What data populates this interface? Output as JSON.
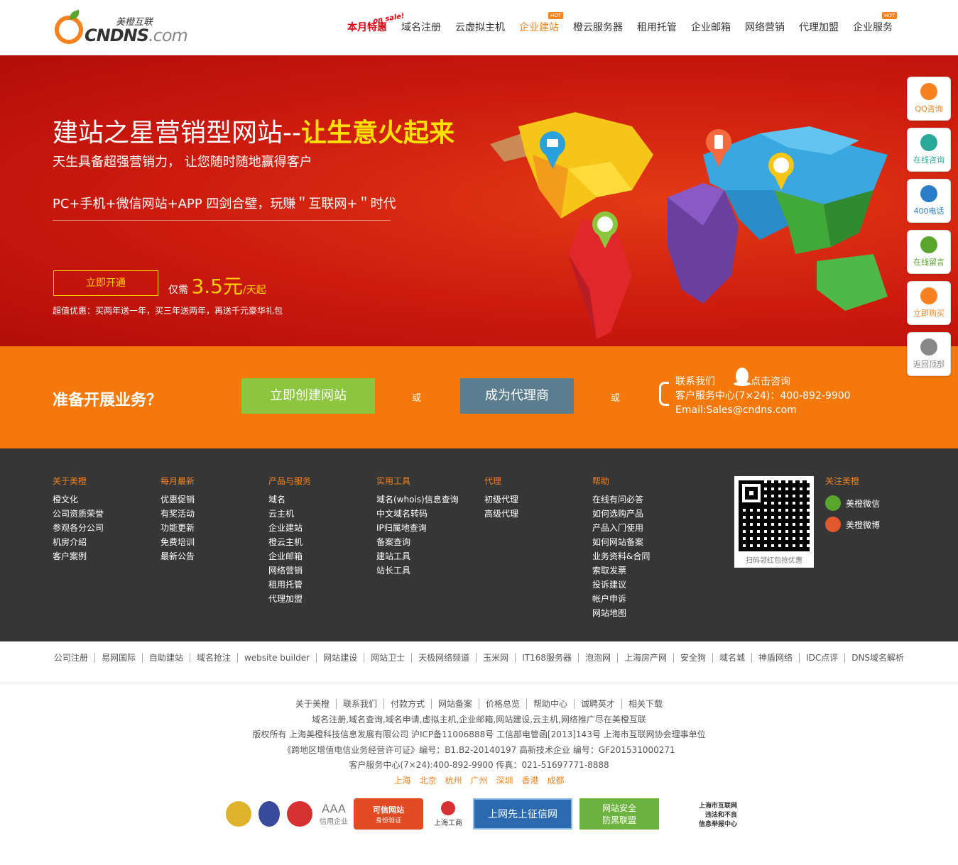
{
  "header": {
    "logo_cn": "美橙互联",
    "logo_brand": "CNDNS",
    "logo_suffix": ".com",
    "onsale": "on sale!",
    "hot": "HOT",
    "nav": [
      {
        "label": "本月特惠"
      },
      {
        "label": "域名注册"
      },
      {
        "label": "云虚拟主机"
      },
      {
        "label": "企业建站"
      },
      {
        "label": "橙云服务器"
      },
      {
        "label": "租用托管"
      },
      {
        "label": "企业邮箱"
      },
      {
        "label": "网络营销"
      },
      {
        "label": "代理加盟"
      },
      {
        "label": "企业服务"
      }
    ]
  },
  "banner": {
    "title_main": "建站之星营销型网站--",
    "title_highlight": "让生意火起来",
    "subtitle": "天生具备超强营销力， 让您随时随地赢得客户",
    "subtitle2": "PC+手机+微信网站+APP 四剑合璧，玩赚＂互联网+＂时代",
    "open_button": "立即开通",
    "price_prefix": "仅需",
    "price_value": "3.5元",
    "price_unit": "/天起",
    "promo": "超值优惠：买两年送一年，买三年送两年，再送千元豪华礼包"
  },
  "band": {
    "question": "准备开展业务？",
    "create_button": "立即创建网站",
    "or": "或",
    "agent_button": "成为代理商",
    "contact_label": "联系我们",
    "consult_label": "点击咨询",
    "service_line": "客户服务中心(7×24)：400-892-9900",
    "email": "Email:Sales@cndns.com"
  },
  "footer": {
    "columns": [
      {
        "head": "关于美橙",
        "items": [
          "橙文化",
          "公司资质荣誉",
          "参观各分公司",
          "机房介绍",
          "客户案例"
        ]
      },
      {
        "head": "每月最新",
        "items": [
          "优惠促销",
          "有奖活动",
          "功能更新",
          "免费培训",
          "最新公告"
        ]
      },
      {
        "head": "产品与服务",
        "items": [
          "域名",
          "云主机",
          "企业建站",
          "橙云主机",
          "企业邮箱",
          "网络营销",
          "租用托管",
          "代理加盟"
        ]
      },
      {
        "head": "实用工具",
        "items": [
          "域名(whois)信息查询",
          "中文域名转码",
          "IP归属地查询",
          "备案查询",
          "建站工具",
          "站长工具"
        ]
      },
      {
        "head": "代理",
        "items": [
          "初级代理",
          "高级代理"
        ]
      },
      {
        "head": "帮助",
        "items": [
          "在线有问必答",
          "如何选购产品",
          "产品入门使用",
          "如何网站备案",
          "业务资料&合同",
          "索取发票",
          "投诉建议",
          "帐户申诉",
          "网站地图"
        ]
      }
    ],
    "qr_caption": "扫码领红包抢优惠",
    "follow_head": "关注美橙",
    "follow_wechat": "美橙微信",
    "follow_weibo": "美橙微博"
  },
  "friend_links": [
    "公司注册",
    "易网国际",
    "自助建站",
    "域名抢注",
    "website builder",
    "网站建设",
    "网站卫士",
    "天极网络频道",
    "玉米网",
    "IT168服务器",
    "泡泡网",
    "上海房产网",
    "安全狗",
    "域名城",
    "神盾网络",
    "IDC点评",
    "DNS域名解析"
  ],
  "bottom": {
    "nav": [
      "关于美橙",
      "联系我们",
      "付款方式",
      "网站备案",
      "价格总览",
      "帮助中心",
      "诚聘英才",
      "相关下载"
    ],
    "line1": "域名注册,域名查询,域名申请,虚拟主机,企业邮箱,网站建设,云主机,网络推广尽在美橙互联",
    "line2": "版权所有 上海美橙科技信息发展有限公司 沪ICP备11006888号 工信部电管函[2013]143号 上海市互联网协会理事单位",
    "line3": "《跨地区增值电信业务经营许可证》编号：B1.B2-20140197 高新技术企业 编号：GF201531000271",
    "line4": "客户服务中心(7×24):400-892-9900 传真：021-51697771-8888",
    "cities": [
      "上海",
      "北京",
      "杭州",
      "广州",
      "深圳",
      "香港",
      "成都"
    ],
    "badges": [
      "AAA",
      "信用企业",
      "可信网站",
      "身份验证",
      "上海工商",
      "上网先上征信网",
      "网站安全",
      "防黑联盟",
      "上海市互联网",
      "违法和不良",
      "信息举报中心"
    ]
  },
  "side": [
    "QQ咨询",
    "在线咨询",
    "400电话",
    "在线留言",
    "立即购买",
    "返回顶部"
  ],
  "colors": {
    "orange": "#f5821f",
    "red": "#cc1a0e",
    "green": "#8cc63f",
    "dark": "#363636"
  }
}
